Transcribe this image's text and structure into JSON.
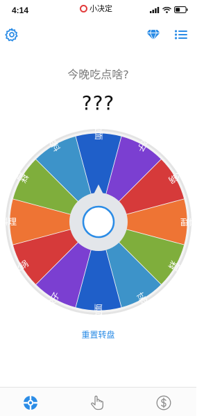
{
  "status_bar": {
    "time": "4:14",
    "app_name": "小决定",
    "record_color": "#e23b3b"
  },
  "nav": {
    "left_icon": "gear-icon",
    "right_icons": [
      "diamond-icon",
      "list-icon"
    ],
    "accent": "#2b8ce6"
  },
  "prompt": "今晚吃点啥?",
  "result": "???",
  "wheel": {
    "segments": [
      {
        "label": "拉面",
        "color": "#1f5fc9"
      },
      {
        "label": "饺子",
        "color": "#7b3fd1"
      },
      {
        "label": "火锅",
        "color": "#d63a3a"
      },
      {
        "label": "日本料理",
        "color": "#ee7434"
      },
      {
        "label": "泰国菜",
        "color": "#7fae3c"
      },
      {
        "label": "火锅底料",
        "color": "#3d93c9"
      },
      {
        "label": "拉面",
        "color": "#1f5fc9"
      },
      {
        "label": "饺子",
        "color": "#7b3fd1"
      },
      {
        "label": "火锅",
        "color": "#d63a3a"
      },
      {
        "label": "日本料理",
        "color": "#ee7434"
      },
      {
        "label": "泰国菜",
        "color": "#7fae3c"
      },
      {
        "label": "火锅底料",
        "color": "#3d93c9"
      }
    ]
  },
  "reset_label": "重置转盘",
  "tabs": [
    {
      "icon": "wheel-icon",
      "active": true
    },
    {
      "icon": "hand-tap-icon",
      "active": false
    },
    {
      "icon": "dollar-icon",
      "active": false
    }
  ]
}
